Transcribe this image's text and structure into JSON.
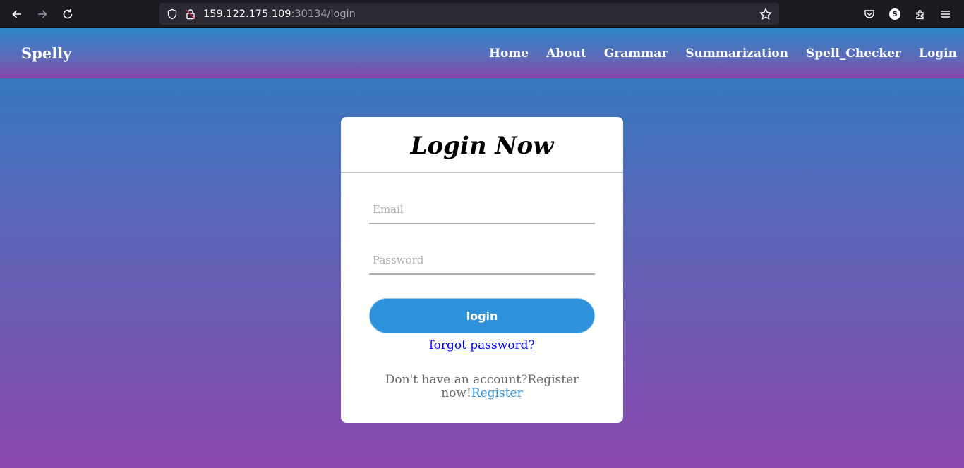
{
  "browser": {
    "url_host": "159.122.175.109",
    "url_path": ":30134/login",
    "profile_initial": "S"
  },
  "nav": {
    "brand": "Spelly",
    "links": [
      "Home",
      "About",
      "Grammar",
      "Summarization",
      "Spell_Checker",
      "Login"
    ]
  },
  "login": {
    "title": "Login Now",
    "email_placeholder": "Email",
    "password_placeholder": "Password",
    "submit_label": "login",
    "forgot_label": "forgot password?",
    "signup_text": "Don't have an account?Register now!",
    "signup_link": "Register"
  },
  "colors": {
    "accent": "#2d91dc",
    "gradient_top": "#2a7dc0",
    "gradient_bottom": "#8a46ad"
  }
}
